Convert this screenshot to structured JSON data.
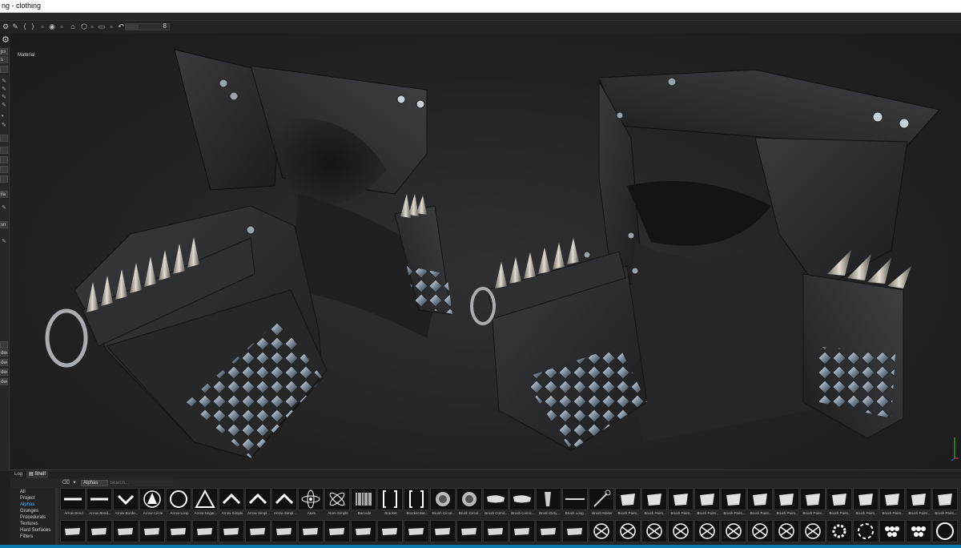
{
  "window": {
    "title": "ng - clothing"
  },
  "toolbar": {
    "slider_value": "8",
    "icons": [
      "settings-icon",
      "brush-icon",
      "symmetry-icon",
      "mirror-icon",
      "checkbox-icon",
      "checkbox-icon",
      "camera-icon",
      "cube-icon",
      "checkbox-icon",
      "monitor-icon",
      "checkbox-icon",
      "checkbox-icon",
      "curve-icon"
    ]
  },
  "left_panel": {
    "fields": [
      "ps",
      "s",
      "ila",
      "sn",
      "der",
      "der",
      "der",
      "der"
    ]
  },
  "viewport": {
    "label": "Material"
  },
  "dock": {
    "tabs": [
      "Log",
      "Shelf"
    ],
    "active_tab": "Shelf",
    "category_select": "Alphas",
    "search_placeholder": "Search..."
  },
  "shelf_categories": {
    "items": [
      "All",
      "Project",
      "Alphas",
      "Grunges",
      "Procedurals",
      "Textures",
      "Hard Surfaces",
      "Filters"
    ],
    "active": "Alphas"
  },
  "shelf_row1": [
    {
      "label": "Arrow Bend",
      "icon": "arrow-bend-icon"
    },
    {
      "label": "Arrow Bend...",
      "icon": "arrow-bend-icon"
    },
    {
      "label": "Arrow Borde...",
      "icon": "arrow-border-icon"
    },
    {
      "label": "Arrow Circle",
      "icon": "arrow-circle-icon"
    },
    {
      "label": "Arrow Loop",
      "icon": "arrow-loop-icon"
    },
    {
      "label": "Arrow Negat...",
      "icon": "arrow-negative-icon"
    },
    {
      "label": "Arrow Simple",
      "icon": "arrow-simple-icon"
    },
    {
      "label": "Arrow Simpl...",
      "icon": "arrow-simple-icon"
    },
    {
      "label": "Arrow Simpl...",
      "icon": "arrow-simple-icon"
    },
    {
      "label": "Atom",
      "icon": "atom-icon"
    },
    {
      "label": "Atom Simple",
      "icon": "atom-simple-icon"
    },
    {
      "label": "Barcode",
      "icon": "barcode-icon"
    },
    {
      "label": "Bracket",
      "icon": "bracket-icon"
    },
    {
      "label": "Bracket Bar...",
      "icon": "bracket-icon"
    },
    {
      "label": "Brush Circul...",
      "icon": "brush-circle-icon"
    },
    {
      "label": "Brush Circul...",
      "icon": "brush-circle-icon"
    },
    {
      "label": "Brush Comic...",
      "icon": "brush-comic-icon"
    },
    {
      "label": "Brush Comic...",
      "icon": "brush-comic-icon"
    },
    {
      "label": "Brush Dirty...",
      "icon": "brush-dirty-icon"
    },
    {
      "label": "Brush Long...",
      "icon": "brush-long-icon"
    },
    {
      "label": "Brush Maker",
      "icon": "brush-maker-icon"
    },
    {
      "label": "Brush Paint...",
      "icon": "brush-paint-icon"
    },
    {
      "label": "Brush Paint...",
      "icon": "brush-paint-icon"
    },
    {
      "label": "Brush Paint...",
      "icon": "brush-paint-icon"
    },
    {
      "label": "Brush Paint...",
      "icon": "brush-paint-icon"
    },
    {
      "label": "Brush Paint...",
      "icon": "brush-paint-icon"
    },
    {
      "label": "Brush Paint...",
      "icon": "brush-paint-icon"
    },
    {
      "label": "Brush Paint...",
      "icon": "brush-paint-icon"
    },
    {
      "label": "Brush Paint...",
      "icon": "brush-paint-icon"
    },
    {
      "label": "Brush Paint...",
      "icon": "brush-paint-icon"
    },
    {
      "label": "Brush Paint...",
      "icon": "brush-paint-icon"
    },
    {
      "label": "Brush Paint...",
      "icon": "brush-paint-icon"
    },
    {
      "label": "Brush Paint...",
      "icon": "brush-paint-icon"
    },
    {
      "label": "Brush Paint...",
      "icon": "brush-paint-icon"
    }
  ],
  "shelf_row2": [
    {
      "icon": "brush-stroke-icon"
    },
    {
      "icon": "brush-stroke-icon"
    },
    {
      "icon": "brush-stroke-icon"
    },
    {
      "icon": "brush-stroke-icon"
    },
    {
      "icon": "brush-stroke-icon"
    },
    {
      "icon": "brush-stroke-icon"
    },
    {
      "icon": "brush-stroke-icon"
    },
    {
      "icon": "brush-stroke-icon"
    },
    {
      "icon": "brush-stroke-icon"
    },
    {
      "icon": "brush-stroke-icon"
    },
    {
      "icon": "brush-stroke-icon"
    },
    {
      "icon": "brush-stroke-icon"
    },
    {
      "icon": "brush-stroke-icon"
    },
    {
      "icon": "brush-stroke-icon"
    },
    {
      "icon": "brush-stroke-icon"
    },
    {
      "icon": "brush-stroke-icon"
    },
    {
      "icon": "brush-stroke-icon"
    },
    {
      "icon": "brush-stroke-icon"
    },
    {
      "icon": "brush-stroke-icon"
    },
    {
      "icon": "brush-stroke-icon"
    },
    {
      "icon": "celtic-knot-icon"
    },
    {
      "icon": "celtic-knot-icon"
    },
    {
      "icon": "celtic-knot-icon"
    },
    {
      "icon": "celtic-knot-icon"
    },
    {
      "icon": "celtic-knot-icon"
    },
    {
      "icon": "celtic-knot-icon"
    },
    {
      "icon": "celtic-knot-icon"
    },
    {
      "icon": "celtic-knot-icon"
    },
    {
      "icon": "celtic-knot-icon"
    },
    {
      "icon": "gear-icon"
    },
    {
      "icon": "circle-dashed-icon"
    },
    {
      "icon": "dots-icon"
    },
    {
      "icon": "dots-icon"
    },
    {
      "icon": "ring-icon"
    }
  ],
  "colors": {
    "accent": "#3fb4ff",
    "statusbar": "#0a7ab0",
    "metal": "#b8bfc6",
    "leather": "#2a2b2e"
  }
}
